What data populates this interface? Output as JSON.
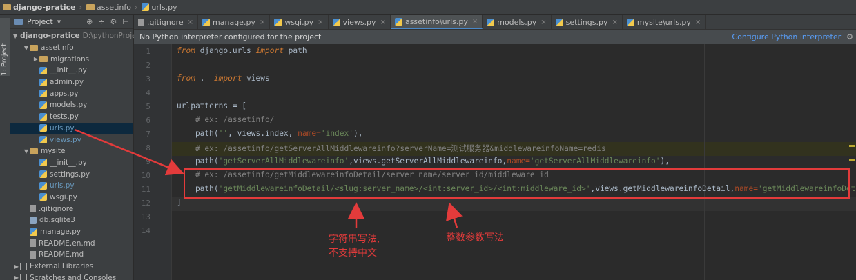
{
  "breadcrumb": [
    "django-pratice",
    "assetinfo",
    "urls.py"
  ],
  "tool_strip": {
    "label": "1: Project"
  },
  "project_panel": {
    "title": "Project",
    "tree": [
      {
        "label": "django-pratice",
        "path": "D:\\pythonProje",
        "kind": "folder",
        "indent": 0,
        "expanded": true,
        "bold": true
      },
      {
        "label": "assetinfo",
        "kind": "folder",
        "indent": 1,
        "expanded": true
      },
      {
        "label": "migrations",
        "kind": "folder",
        "indent": 2,
        "expanded": false
      },
      {
        "label": "__init__.py",
        "kind": "py",
        "indent": 2
      },
      {
        "label": "admin.py",
        "kind": "py",
        "indent": 2
      },
      {
        "label": "apps.py",
        "kind": "py",
        "indent": 2
      },
      {
        "label": "models.py",
        "kind": "py",
        "indent": 2
      },
      {
        "label": "tests.py",
        "kind": "py",
        "indent": 2
      },
      {
        "label": "urls.py",
        "kind": "py",
        "indent": 2,
        "selected": true,
        "blue": true
      },
      {
        "label": "views.py",
        "kind": "py",
        "indent": 2,
        "blue": true
      },
      {
        "label": "mysite",
        "kind": "folder",
        "indent": 1,
        "expanded": true
      },
      {
        "label": "__init__.py",
        "kind": "py",
        "indent": 2
      },
      {
        "label": "settings.py",
        "kind": "py",
        "indent": 2
      },
      {
        "label": "urls.py",
        "kind": "py",
        "indent": 2,
        "blue": true
      },
      {
        "label": "wsgi.py",
        "kind": "py",
        "indent": 2
      },
      {
        "label": ".gitignore",
        "kind": "file",
        "indent": 1
      },
      {
        "label": "db.sqlite3",
        "kind": "db",
        "indent": 1
      },
      {
        "label": "manage.py",
        "kind": "py",
        "indent": 1
      },
      {
        "label": "README.en.md",
        "kind": "file",
        "indent": 1
      },
      {
        "label": "README.md",
        "kind": "file",
        "indent": 1
      },
      {
        "label": "External Libraries",
        "kind": "lib",
        "indent": 0,
        "expanded": false
      },
      {
        "label": "Scratches and Consoles",
        "kind": "lib",
        "indent": 0,
        "expanded": false
      }
    ]
  },
  "tabs": [
    {
      "label": ".gitignore",
      "active": false
    },
    {
      "label": "manage.py",
      "active": false
    },
    {
      "label": "wsgi.py",
      "active": false
    },
    {
      "label": "views.py",
      "active": false
    },
    {
      "label": "assetinfo\\urls.py",
      "active": true
    },
    {
      "label": "models.py",
      "active": false
    },
    {
      "label": "settings.py",
      "active": false
    },
    {
      "label": "mysite\\urls.py",
      "active": false
    }
  ],
  "banner": {
    "message": "No Python interpreter configured for the project",
    "action": "Configure Python interpreter"
  },
  "line_numbers": [
    "1",
    "2",
    "3",
    "4",
    "5",
    "6",
    "7",
    "8",
    "9",
    "10",
    "11",
    "12",
    "13",
    "14"
  ],
  "code_lines": [
    [
      {
        "t": "from",
        "c": "kw"
      },
      {
        "t": " django.urls "
      },
      {
        "t": "import",
        "c": "kw"
      },
      {
        "t": " path"
      }
    ],
    [],
    [
      {
        "t": "from",
        "c": "kw"
      },
      {
        "t": " . "
      },
      {
        "t": " import",
        "c": "kw"
      },
      {
        "t": " views"
      }
    ],
    [],
    [
      {
        "t": "urlpatterns = ["
      }
    ],
    [
      {
        "t": "    "
      },
      {
        "t": "# ex: /",
        "c": "cm"
      },
      {
        "t": "assetinfo",
        "c": "cm ul"
      },
      {
        "t": "/",
        "c": "cm"
      }
    ],
    [
      {
        "t": "    path("
      },
      {
        "t": "''",
        "c": "st"
      },
      {
        "t": ", views.index, "
      },
      {
        "t": "name=",
        "c": "pn"
      },
      {
        "t": "'index'",
        "c": "st"
      },
      {
        "t": "),"
      }
    ],
    [
      {
        "t": "    "
      },
      {
        "t": "# ex: /assetinfo/getServerAllMiddlewareinfo?serverName=测试服务器&middlewareinfoName=redis",
        "c": "cm ul"
      }
    ],
    [
      {
        "t": "    path("
      },
      {
        "t": "'getServerAllMiddlewareinfo'",
        "c": "st"
      },
      {
        "t": ",views.getServerAllMiddlewareinfo,"
      },
      {
        "t": "name=",
        "c": "pn"
      },
      {
        "t": "'getServerAllMiddlewareinfo'",
        "c": "st"
      },
      {
        "t": "),"
      }
    ],
    [
      {
        "t": "    "
      },
      {
        "t": "# ex: /assetinfo/getMiddlewareinfoDetail/server_name/server_id/middleware_id",
        "c": "cm"
      }
    ],
    [
      {
        "t": "    path("
      },
      {
        "t": "'getMiddlewareinfoDetail/<slug:server_name>/<int:server_id>/<int:middleware_id>'",
        "c": "st"
      },
      {
        "t": ",views.getMiddlewareinfoDetail,"
      },
      {
        "t": "name=",
        "c": "pn"
      },
      {
        "t": "'getMiddlewareinfoDetail'",
        "c": "st"
      },
      {
        "t": "),"
      }
    ],
    [
      {
        "t": "]"
      }
    ],
    [],
    []
  ],
  "annotations": {
    "string_note_line1": "字符串写法,",
    "string_note_line2": "不支持中文",
    "int_note": "整数参数写法"
  },
  "colors": {
    "annotation_red": "#e33b3b",
    "accent_blue": "#4a88c7"
  }
}
